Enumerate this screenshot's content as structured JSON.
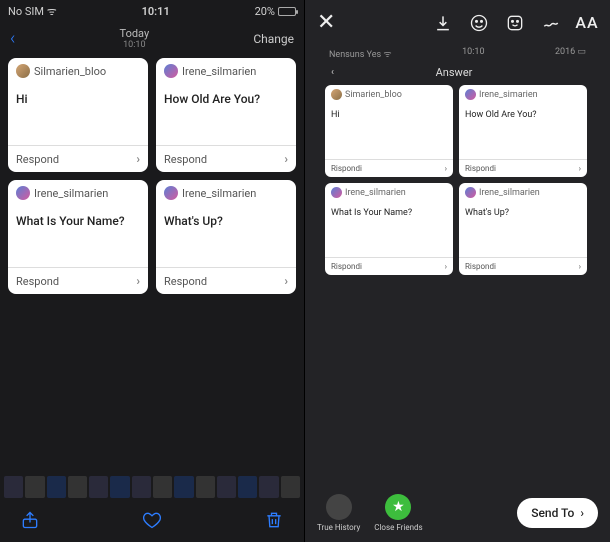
{
  "left": {
    "status": {
      "carrier": "No SIM",
      "wifi": "􀙇",
      "time": "10:11",
      "battery_pct": "20%"
    },
    "nav": {
      "title": "Today",
      "subtitle": "10:10",
      "change": "Change"
    },
    "cards": [
      {
        "user": "Silmarien_bloo",
        "msg": "Hi",
        "action": "Respond"
      },
      {
        "user": "Irene_silmarien",
        "msg": "How Old Are You?",
        "action": "Respond"
      },
      {
        "user": "Irene_silmarien",
        "msg": "What Is Your Name?",
        "action": "Respond"
      },
      {
        "user": "Irene_silmarien",
        "msg": "What's Up?",
        "action": "Respond"
      }
    ]
  },
  "right": {
    "preview": {
      "status": {
        "carrier": "Nensuns Yes",
        "time": "10:10",
        "battery": "2016"
      },
      "nav_title": "Answer",
      "cards": [
        {
          "user": "Simarien_bloo",
          "msg": "Hi",
          "action": "Rispondi"
        },
        {
          "user": "Irene_simarien",
          "msg": "How Old Are You?",
          "action": "Rispondi"
        },
        {
          "user": "Irene_silmarien",
          "msg": "What Is Your Name?",
          "action": "Rispondi"
        },
        {
          "user": "Irene_silmarien",
          "msg": "What's Up?",
          "action": "Rispondi"
        }
      ]
    },
    "bottom": {
      "opt1": "True History",
      "opt2": "Close Friends",
      "send": "Send To"
    }
  }
}
